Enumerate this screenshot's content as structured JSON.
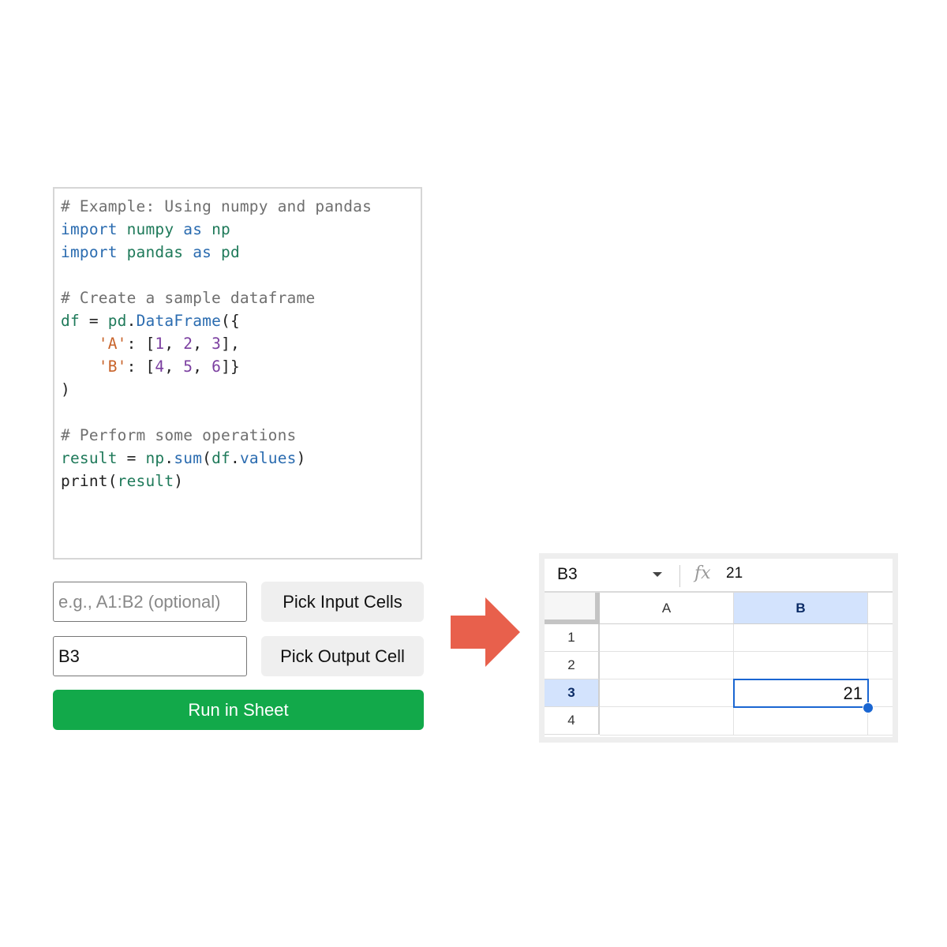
{
  "code_editor": {
    "lines": [
      [
        {
          "t": "# Example: Using numpy and pandas",
          "c": "comment"
        }
      ],
      [
        {
          "t": "import",
          "c": "kw"
        },
        {
          "t": " ",
          "c": "plain"
        },
        {
          "t": "numpy",
          "c": "name"
        },
        {
          "t": " ",
          "c": "plain"
        },
        {
          "t": "as",
          "c": "kw"
        },
        {
          "t": " ",
          "c": "plain"
        },
        {
          "t": "np",
          "c": "name"
        }
      ],
      [
        {
          "t": "import",
          "c": "kw"
        },
        {
          "t": " ",
          "c": "plain"
        },
        {
          "t": "pandas",
          "c": "name"
        },
        {
          "t": " ",
          "c": "plain"
        },
        {
          "t": "as",
          "c": "kw"
        },
        {
          "t": " ",
          "c": "plain"
        },
        {
          "t": "pd",
          "c": "name"
        }
      ],
      [],
      [
        {
          "t": "# Create a sample dataframe",
          "c": "comment"
        }
      ],
      [
        {
          "t": "df",
          "c": "name"
        },
        {
          "t": " = ",
          "c": "plain"
        },
        {
          "t": "pd",
          "c": "name"
        },
        {
          "t": ".",
          "c": "plain"
        },
        {
          "t": "DataFrame",
          "c": "attr"
        },
        {
          "t": "({",
          "c": "plain"
        }
      ],
      [
        {
          "t": "    ",
          "c": "plain"
        },
        {
          "t": "'A'",
          "c": "str"
        },
        {
          "t": ": [",
          "c": "plain"
        },
        {
          "t": "1",
          "c": "num"
        },
        {
          "t": ", ",
          "c": "plain"
        },
        {
          "t": "2",
          "c": "num"
        },
        {
          "t": ", ",
          "c": "plain"
        },
        {
          "t": "3",
          "c": "num"
        },
        {
          "t": "],",
          "c": "plain"
        }
      ],
      [
        {
          "t": "    ",
          "c": "plain"
        },
        {
          "t": "'B'",
          "c": "str"
        },
        {
          "t": ": [",
          "c": "plain"
        },
        {
          "t": "4",
          "c": "num"
        },
        {
          "t": ", ",
          "c": "plain"
        },
        {
          "t": "5",
          "c": "num"
        },
        {
          "t": ", ",
          "c": "plain"
        },
        {
          "t": "6",
          "c": "num"
        },
        {
          "t": "]}",
          "c": "plain"
        }
      ],
      [
        {
          "t": ")",
          "c": "plain"
        }
      ],
      [],
      [
        {
          "t": "# Perform some operations",
          "c": "comment"
        }
      ],
      [
        {
          "t": "result",
          "c": "name"
        },
        {
          "t": " = ",
          "c": "plain"
        },
        {
          "t": "np",
          "c": "name"
        },
        {
          "t": ".",
          "c": "plain"
        },
        {
          "t": "sum",
          "c": "attr"
        },
        {
          "t": "(",
          "c": "plain"
        },
        {
          "t": "df",
          "c": "name"
        },
        {
          "t": ".",
          "c": "plain"
        },
        {
          "t": "values",
          "c": "attr"
        },
        {
          "t": ")",
          "c": "plain"
        }
      ],
      [
        {
          "t": "print",
          "c": "plain"
        },
        {
          "t": "(",
          "c": "plain"
        },
        {
          "t": "result",
          "c": "name"
        },
        {
          "t": ")",
          "c": "plain"
        }
      ]
    ]
  },
  "controls": {
    "input_range": {
      "value": "",
      "placeholder": "e.g., A1:B2 (optional)"
    },
    "pick_input_label": "Pick Input Cells",
    "output_cell": {
      "value": "B3",
      "placeholder": ""
    },
    "pick_output_label": "Pick Output Cell",
    "run_label": "Run in Sheet"
  },
  "colors": {
    "run_button": "#12a94a",
    "arrow": "#e8604c",
    "selection": "#1a66d2",
    "header_highlight": "#d3e3fd"
  },
  "arrow": {
    "icon": "right-arrow-icon"
  },
  "sheet": {
    "name_box": "B3",
    "fx_icon": "fx",
    "formula_value": "21",
    "columns": [
      "A",
      "B"
    ],
    "selected_column": "B",
    "rows": [
      "1",
      "2",
      "3",
      "4"
    ],
    "selected_row": "3",
    "cells": {
      "B3": "21"
    }
  }
}
